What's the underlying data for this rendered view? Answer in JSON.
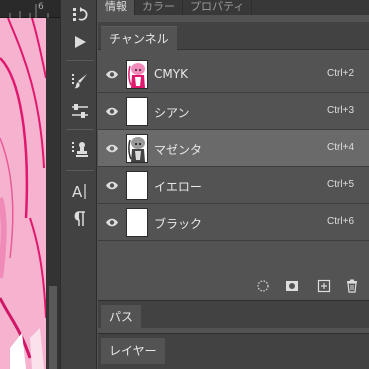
{
  "ruler": {
    "mark": "6"
  },
  "top_tabs": [
    {
      "label": "情報"
    },
    {
      "label": "カラー"
    },
    {
      "label": "プロパティ"
    }
  ],
  "channels_panel": {
    "tab_label": "チャンネル",
    "rows": [
      {
        "label": "CMYK",
        "shortcut": "Ctrl+2",
        "thumb": "color"
      },
      {
        "label": "シアン",
        "shortcut": "Ctrl+3",
        "thumb": "blank"
      },
      {
        "label": "マゼンタ",
        "shortcut": "Ctrl+4",
        "thumb": "gray",
        "selected": true
      },
      {
        "label": "イエロー",
        "shortcut": "Ctrl+5",
        "thumb": "blank"
      },
      {
        "label": "ブラック",
        "shortcut": "Ctrl+6",
        "thumb": "blank"
      }
    ],
    "footer_icons": [
      "load-selection-icon",
      "save-selection-icon",
      "new-channel-icon",
      "trash-icon"
    ]
  },
  "paths_panel": {
    "tab_label": "パス"
  },
  "layers_panel": {
    "tab_label": "レイヤー"
  },
  "colors": {
    "panel_bg": "#535353",
    "header_bg": "#424242",
    "selected_row": "#6a6a6a",
    "canvas_pink": "#f4a9c8",
    "art_magenta": "#e0196f"
  }
}
